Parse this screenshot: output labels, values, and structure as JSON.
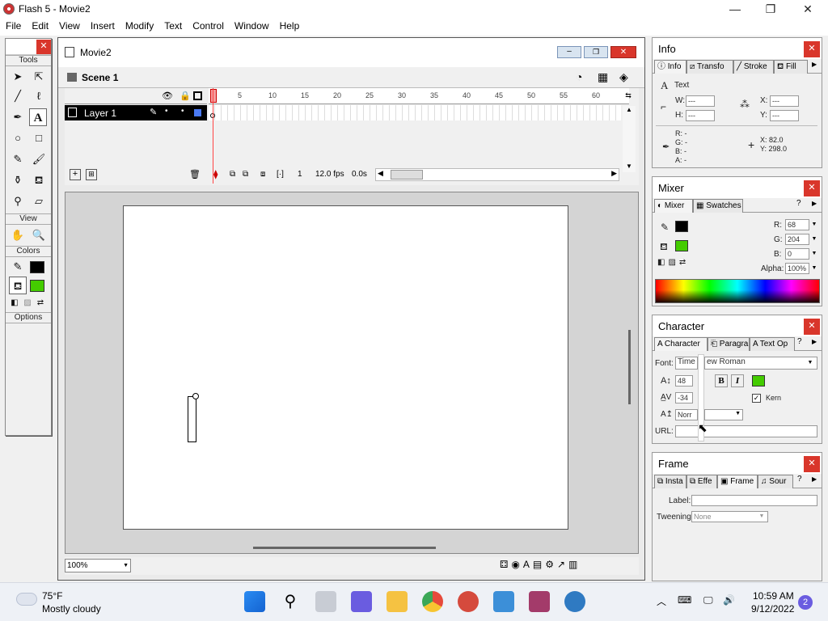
{
  "app": {
    "title": "Flash 5 - Movie2"
  },
  "window_controls": {
    "minimize": "—",
    "maximize": "❐",
    "close": "✕"
  },
  "menu": [
    "File",
    "Edit",
    "View",
    "Insert",
    "Modify",
    "Text",
    "Control",
    "Window",
    "Help"
  ],
  "tools": {
    "title": "Tools",
    "sections": {
      "view": "View",
      "colors": "Colors",
      "options": "Options"
    },
    "stroke_color": "#000000",
    "fill_color": "#44cc00"
  },
  "movie": {
    "title": "Movie2",
    "scene": "Scene 1",
    "layer": "Layer 1",
    "frame_ticks": [
      "5",
      "10",
      "15",
      "20",
      "25",
      "30",
      "35",
      "40",
      "45",
      "50",
      "55",
      "60"
    ],
    "current_frame": "1",
    "fps": "12.0 fps",
    "time": "0.0s",
    "zoom": "100%"
  },
  "info_panel": {
    "title": "Info",
    "tabs": [
      "Info",
      "Transfo",
      "Stroke",
      "Fill"
    ],
    "object": "Text",
    "w_label": "W:",
    "w_val": "---",
    "h_label": "H:",
    "h_val": "---",
    "x_label": "X:",
    "x_val": "---",
    "y_label": "Y:",
    "y_val": "---",
    "r": "R: -",
    "g": "G: -",
    "b": "B: -",
    "a": "A: -",
    "cursor_x": "X: 82.0",
    "cursor_y": "Y: 298.0"
  },
  "mixer_panel": {
    "title": "Mixer",
    "tabs": [
      "Mixer",
      "Swatches"
    ],
    "r_label": "R:",
    "r": "68",
    "g_label": "G:",
    "g": "204",
    "b_label": "B:",
    "b": "0",
    "alpha_label": "Alpha:",
    "alpha": "100%",
    "stroke_color": "#000000",
    "fill_color": "#44cc00"
  },
  "character_panel": {
    "title": "Character",
    "tabs": [
      "Character",
      "Paragra",
      "Text Op"
    ],
    "font_label": "Font:",
    "font_part1": "Time",
    "font_part2": "ew Roman",
    "size": "48",
    "tracking": "-34",
    "baseline": "Norr",
    "bold": "B",
    "italic": "I",
    "text_color": "#44cc00",
    "kern_label": "Kern",
    "url_label": "URL:"
  },
  "frame_panel": {
    "title": "Frame",
    "tabs": [
      "Insta",
      "Effe",
      "Frame",
      "Sour"
    ],
    "label_label": "Label:",
    "tweening_label": "Tweening:",
    "tweening_value": "None"
  },
  "taskbar": {
    "weather_temp": "75°F",
    "weather_desc": "Mostly cloudy",
    "time": "10:59 AM",
    "date": "9/12/2022",
    "notifications": "2"
  }
}
